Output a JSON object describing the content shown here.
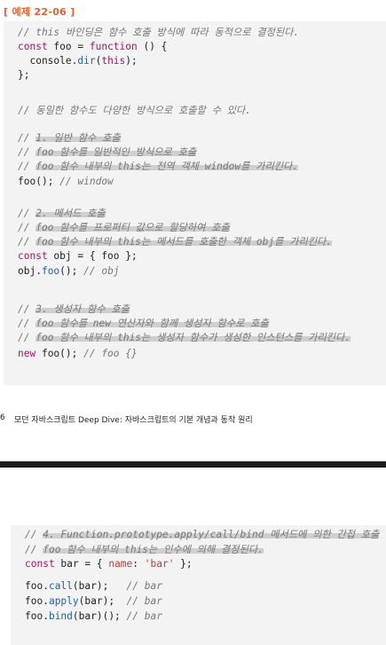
{
  "example_label": "[ 예제 22-06 ]",
  "code_lines": [
    {
      "segments": [
        {
          "t": "// this 바인딩은 함수 호출 방식에 따라 동적으로 결정된다.",
          "c": "cm"
        }
      ]
    },
    {
      "segments": [
        {
          "t": "const",
          "c": "kw"
        },
        {
          "t": " foo = ",
          "c": ""
        },
        {
          "t": "function",
          "c": "kw"
        },
        {
          "t": " () {",
          "c": ""
        }
      ]
    },
    {
      "segments": [
        {
          "t": "  console.",
          "c": ""
        },
        {
          "t": "dir",
          "c": "fn"
        },
        {
          "t": "(",
          "c": ""
        },
        {
          "t": "this",
          "c": "kw"
        },
        {
          "t": ");",
          "c": ""
        }
      ]
    },
    {
      "segments": [
        {
          "t": "};",
          "c": ""
        }
      ]
    },
    {
      "segments": [
        {
          "t": "// 동일한 함수도 다양한 방식으로 호출할 수 있다.",
          "c": "cm"
        }
      ]
    },
    {
      "segments": [
        {
          "t": "// ",
          "c": "cm"
        },
        {
          "t": "1. 일반 함수 호출",
          "c": "cm hl"
        }
      ]
    },
    {
      "segments": [
        {
          "t": "// ",
          "c": "cm"
        },
        {
          "t": "foo 함수를 일반적인 방식으로 호출",
          "c": "cm hl"
        }
      ]
    },
    {
      "segments": [
        {
          "t": "// ",
          "c": "cm"
        },
        {
          "t": "foo 함수 내부의 this는 전역 객체 window를 가리킨다.",
          "c": "cm hl"
        }
      ]
    },
    {
      "segments": [
        {
          "t": "foo",
          "c": ""
        },
        {
          "t": "(); ",
          "c": ""
        },
        {
          "t": "// window",
          "c": "cm"
        }
      ]
    },
    {
      "segments": [
        {
          "t": "// ",
          "c": "cm"
        },
        {
          "t": "2. 메서드 호출",
          "c": "cm hl"
        }
      ]
    },
    {
      "segments": [
        {
          "t": "// ",
          "c": "cm"
        },
        {
          "t": "foo 함수를 프로퍼티 값으로 할당하여 호출",
          "c": "cm hl"
        }
      ]
    },
    {
      "segments": [
        {
          "t": "// ",
          "c": "cm"
        },
        {
          "t": "foo 함수 내부의 this는 메서드를 호출한 객체 obj를 가리킨다.",
          "c": "cm hl"
        }
      ]
    },
    {
      "segments": [
        {
          "t": "const",
          "c": "kw"
        },
        {
          "t": " obj = { foo };",
          "c": ""
        }
      ]
    },
    {
      "segments": [
        {
          "t": "obj.",
          "c": ""
        },
        {
          "t": "foo",
          "c": "fn"
        },
        {
          "t": "(); ",
          "c": ""
        },
        {
          "t": "// obj",
          "c": "cm"
        }
      ]
    },
    {
      "segments": [
        {
          "t": "// ",
          "c": "cm"
        },
        {
          "t": "3. 생성자 함수 호출",
          "c": "cm hl"
        }
      ]
    },
    {
      "segments": [
        {
          "t": "// ",
          "c": "cm"
        },
        {
          "t": "foo 함수를 new 연산자와 함께 생성자 함수로 호출",
          "c": "cm hl"
        }
      ]
    },
    {
      "segments": [
        {
          "t": "// ",
          "c": "cm"
        },
        {
          "t": "foo 함수 내부의 this는 생성자 함수가 생성한 인스턴스를 가리킨다.",
          "c": "cm hl"
        }
      ]
    },
    {
      "segments": [
        {
          "t": "new",
          "c": "kw"
        },
        {
          "t": " foo(); ",
          "c": ""
        },
        {
          "t": "// foo {}",
          "c": "cm"
        }
      ]
    }
  ],
  "page_number": "6",
  "footer_text": "모던 자바스크립트 Deep Dive: 자바스크립트의 기본 개념과 동작 원리",
  "code_lines_2": [
    {
      "segments": [
        {
          "t": "// ",
          "c": "cm"
        },
        {
          "t": "4. Function.prototype.apply/call/bind 메서드에 의한 간접 호출",
          "c": "cm hl"
        }
      ]
    },
    {
      "segments": [
        {
          "t": "// ",
          "c": "cm"
        },
        {
          "t": "foo 함수 내부의 this는 인수에 의해 결정된다.",
          "c": "cm hl"
        }
      ]
    },
    {
      "segments": [
        {
          "t": "const",
          "c": "kw"
        },
        {
          "t": " bar = { ",
          "c": ""
        },
        {
          "t": "name",
          "c": "str"
        },
        {
          "t": ": ",
          "c": ""
        },
        {
          "t": "'bar'",
          "c": "str"
        },
        {
          "t": " };",
          "c": ""
        }
      ]
    },
    {
      "segments": [
        {
          "t": "foo.",
          "c": ""
        },
        {
          "t": "call",
          "c": "fn"
        },
        {
          "t": "(bar);   ",
          "c": ""
        },
        {
          "t": "// bar",
          "c": "cm"
        }
      ]
    },
    {
      "segments": [
        {
          "t": "foo.",
          "c": ""
        },
        {
          "t": "apply",
          "c": "fn"
        },
        {
          "t": "(bar);  ",
          "c": ""
        },
        {
          "t": "// bar",
          "c": "cm"
        }
      ]
    },
    {
      "segments": [
        {
          "t": "foo.",
          "c": ""
        },
        {
          "t": "bind",
          "c": "fn"
        },
        {
          "t": "(bar)(); ",
          "c": ""
        },
        {
          "t": "// bar",
          "c": "cm"
        }
      ]
    }
  ]
}
